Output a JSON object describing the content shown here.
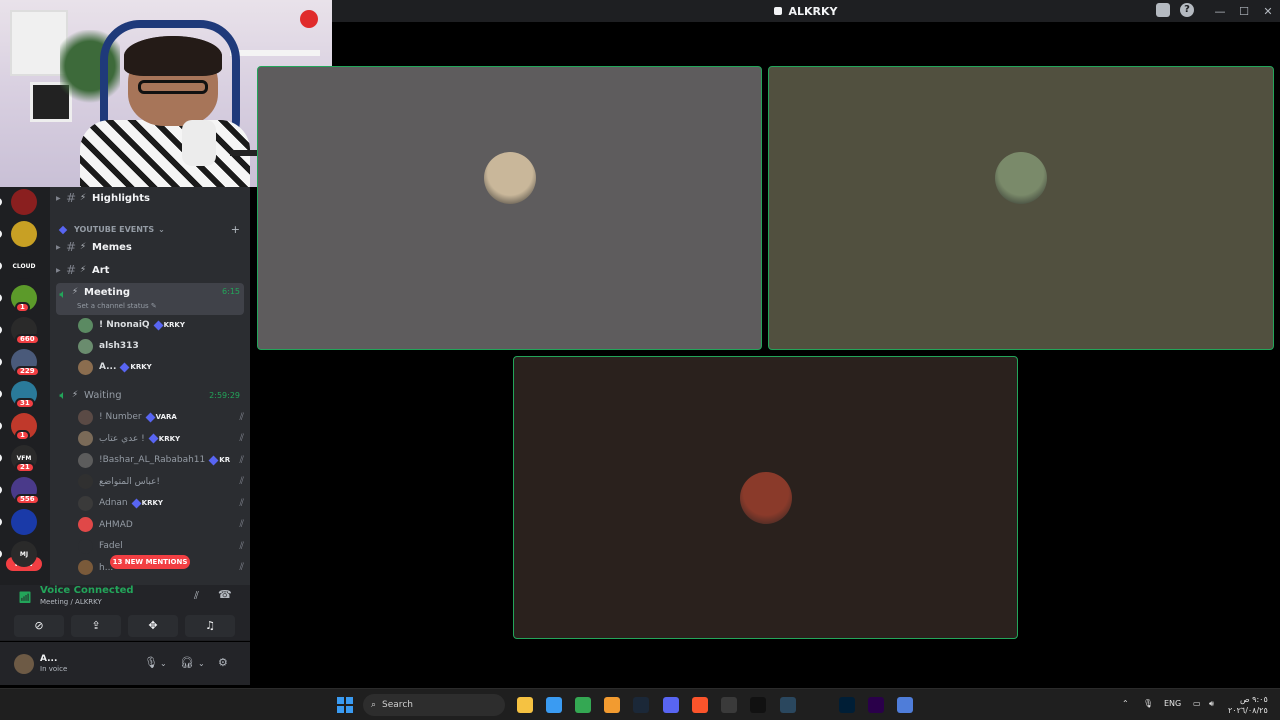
{
  "window": {
    "title": "ALKRKY",
    "help_label": "?"
  },
  "window_controls": [
    "—",
    "☐",
    "✕"
  ],
  "channels": [
    {
      "name": "Highlights",
      "type": "text"
    },
    {
      "name": "Memes",
      "type": "text"
    },
    {
      "name": "Art",
      "type": "text"
    }
  ],
  "category": {
    "name": "YOUTUBE EVENTS",
    "add": "+"
  },
  "meeting": {
    "name": "Meeting",
    "timer": "6:15",
    "status_hint": "Set a channel status",
    "members": [
      {
        "name": "! NnonaiQ",
        "tag": "KRKY",
        "avatar_color": "#5b8a62"
      },
      {
        "name": "alsh313",
        "tag": "",
        "avatar_color": "#6a8c6e"
      },
      {
        "name": "A...",
        "tag": "KRKY",
        "avatar_color": "#8b6d4f"
      }
    ]
  },
  "waiting": {
    "name": "Waiting",
    "timer": "2:59:29",
    "members": [
      {
        "name": "! Number",
        "tag": "VARA",
        "avatar_color": "#5a4a45"
      },
      {
        "name": "عدي عتاب !",
        "tag": "KRKY",
        "avatar_color": "#7a6a58"
      },
      {
        "name": "!Bashar_AL_Rababah11",
        "tag": "KR",
        "avatar_color": "#5c5c5c"
      },
      {
        "name": "عباس المتواضع!",
        "tag": "",
        "avatar_color": "#303030"
      },
      {
        "name": "Adnan",
        "tag": "KRKY",
        "avatar_color": "#3a3a3a"
      },
      {
        "name": "AHMAD",
        "tag": "",
        "avatar_color": "#e04848"
      },
      {
        "name": "Fadel",
        "tag": "",
        "avatar_color": "#2b2d31"
      },
      {
        "name": "h...",
        "tag": "",
        "avatar_color": "#7a5a3a"
      }
    ],
    "deafened_icon": "deafened-icon"
  },
  "mentions_label": "13 NEW MENTIONS",
  "servers": [
    {
      "color": "#8a1f1f",
      "badge": "",
      "label": ""
    },
    {
      "color": "#c8a024",
      "badge": "",
      "label": ""
    },
    {
      "color": "#1e1f22",
      "badge": "",
      "label": "CLOUD"
    },
    {
      "color": "#5c9a2a",
      "badge": "1",
      "label": ""
    },
    {
      "color": "#2a2a2a",
      "badge": "660",
      "label": ""
    },
    {
      "color": "#4a5a7a",
      "badge": "229",
      "label": ""
    },
    {
      "color": "#2a7a9a",
      "badge": "31",
      "label": ""
    },
    {
      "color": "#c0392b",
      "badge": "1",
      "label": ""
    },
    {
      "color": "#2a2a2a",
      "badge": "21",
      "label": "VFM"
    },
    {
      "color": "#4a3a8a",
      "badge": "556",
      "label": ""
    },
    {
      "color": "#1a3aa8",
      "badge": "",
      "label": ""
    },
    {
      "color": "#2a2a2a",
      "badge": "",
      "label": "MJ"
    }
  ],
  "rail_new_label": "NEW",
  "voice": {
    "status": "Voice Connected",
    "location": "Meeting / ALKRKY"
  },
  "voice_buttons": [
    "camera-off-icon",
    "screen-share-icon",
    "activities-icon",
    "soundboard-icon"
  ],
  "user": {
    "name": "A...",
    "status": "In voice"
  },
  "tiles": [
    {
      "bg": "#5e5c5d",
      "avatar_color": "#c9b79a"
    },
    {
      "bg": "#51503f",
      "avatar_color": "#7a8a6a"
    },
    {
      "bg": "#2a211d",
      "avatar_color": "#8a3a2a"
    }
  ],
  "taskbar": {
    "search_placeholder": "Search",
    "apps": [
      {
        "name": "file-explorer-icon",
        "color": "#f5c242"
      },
      {
        "name": "store-icon",
        "color": "#3a9bf2"
      },
      {
        "name": "chrome-icon",
        "color": "#34a853"
      },
      {
        "name": "steelseries-icon",
        "color": "#f29b30"
      },
      {
        "name": "steam-icon",
        "color": "#1b2838"
      },
      {
        "name": "discord-icon",
        "color": "#5865f2"
      },
      {
        "name": "brave-icon",
        "color": "#fb542b"
      },
      {
        "name": "obs-icon",
        "color": "#3a3a3a"
      },
      {
        "name": "capcut-icon",
        "color": "#111111"
      },
      {
        "name": "steam-client-icon",
        "color": "#2a475e"
      },
      {
        "name": "photoshop-icon",
        "color": "#001e36"
      },
      {
        "name": "premiere-icon",
        "color": "#2a004a"
      },
      {
        "name": "blue-app-icon",
        "color": "#4f7dd9"
      }
    ],
    "lang": "ENG",
    "time": "٩:٠٥ ص",
    "date": "٢٠٢٦/٠٨/٢٥"
  }
}
